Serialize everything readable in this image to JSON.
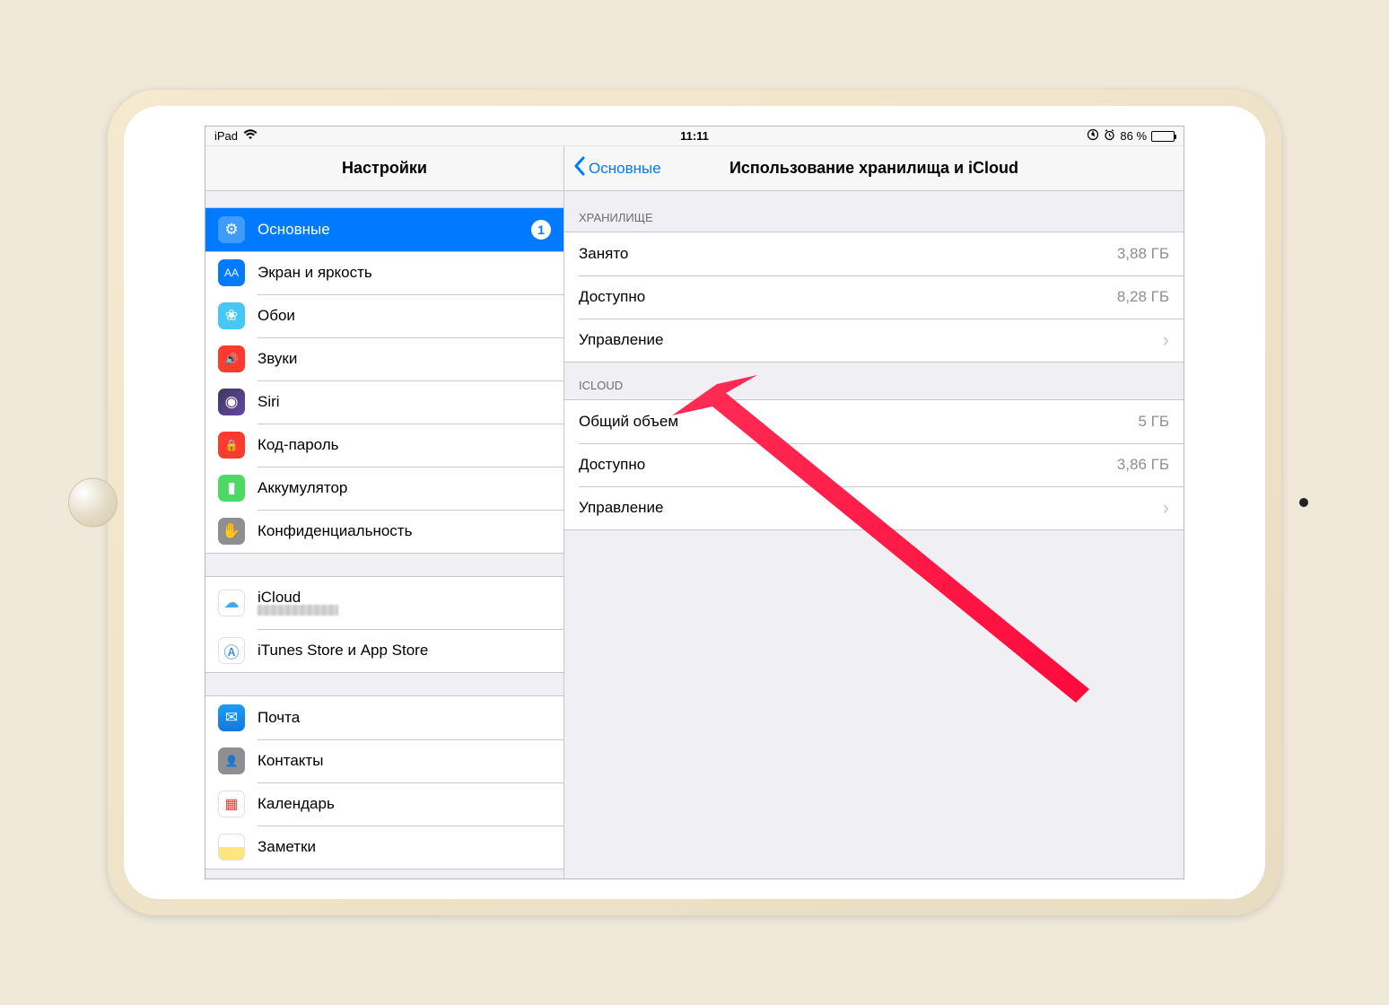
{
  "status": {
    "device": "iPad",
    "time": "11:11",
    "battery_pct": "86 %"
  },
  "sidebar": {
    "title": "Настройки",
    "group1": [
      {
        "label": "Основные",
        "badge": "1",
        "icon": "gear-icon",
        "ic_class": "ic-general",
        "glyph": "⚙",
        "selected": true
      },
      {
        "label": "Экран и яркость",
        "icon": "display-icon",
        "ic_class": "ic-display",
        "glyph": "AA"
      },
      {
        "label": "Обои",
        "icon": "wallpaper-icon",
        "ic_class": "ic-wallpaper",
        "glyph": "❀"
      },
      {
        "label": "Звуки",
        "icon": "sounds-icon",
        "ic_class": "ic-sounds",
        "glyph": "🔊"
      },
      {
        "label": "Siri",
        "icon": "siri-icon",
        "ic_class": "ic-siri",
        "glyph": "◉"
      },
      {
        "label": "Код-пароль",
        "icon": "passcode-icon",
        "ic_class": "ic-passcode",
        "glyph": "🔒"
      },
      {
        "label": "Аккумулятор",
        "icon": "battery-icon",
        "ic_class": "ic-battery",
        "glyph": "▮"
      },
      {
        "label": "Конфиденциальность",
        "icon": "privacy-icon",
        "ic_class": "ic-privacy",
        "glyph": "✋"
      }
    ],
    "group2": [
      {
        "label": "iCloud",
        "icon": "icloud-icon",
        "ic_class": "ic-icloud",
        "glyph": "☁",
        "has_sub": true
      },
      {
        "label": "iTunes Store и App Store",
        "icon": "appstore-icon",
        "ic_class": "ic-itunes",
        "glyph": "Ⓐ"
      }
    ],
    "group3": [
      {
        "label": "Почта",
        "icon": "mail-icon",
        "ic_class": "ic-mail",
        "glyph": "✉"
      },
      {
        "label": "Контакты",
        "icon": "contacts-icon",
        "ic_class": "ic-contacts",
        "glyph": "👤"
      },
      {
        "label": "Календарь",
        "icon": "calendar-icon",
        "ic_class": "ic-calendar",
        "glyph": "▦"
      },
      {
        "label": "Заметки",
        "icon": "notes-icon",
        "ic_class": "ic-notes",
        "glyph": ""
      }
    ]
  },
  "detail": {
    "back_label": "Основные",
    "title": "Использование хранилища и iCloud",
    "storage_header": "ХРАНИЛИЩЕ",
    "storage_rows": [
      {
        "label": "Занято",
        "value": "3,88 ГБ"
      },
      {
        "label": "Доступно",
        "value": "8,28 ГБ"
      },
      {
        "label": "Управление",
        "chevron": true
      }
    ],
    "icloud_header": "ICLOUD",
    "icloud_rows": [
      {
        "label": "Общий объем",
        "value": "5 ГБ"
      },
      {
        "label": "Доступно",
        "value": "3,86 ГБ"
      },
      {
        "label": "Управление",
        "chevron": true
      }
    ]
  }
}
